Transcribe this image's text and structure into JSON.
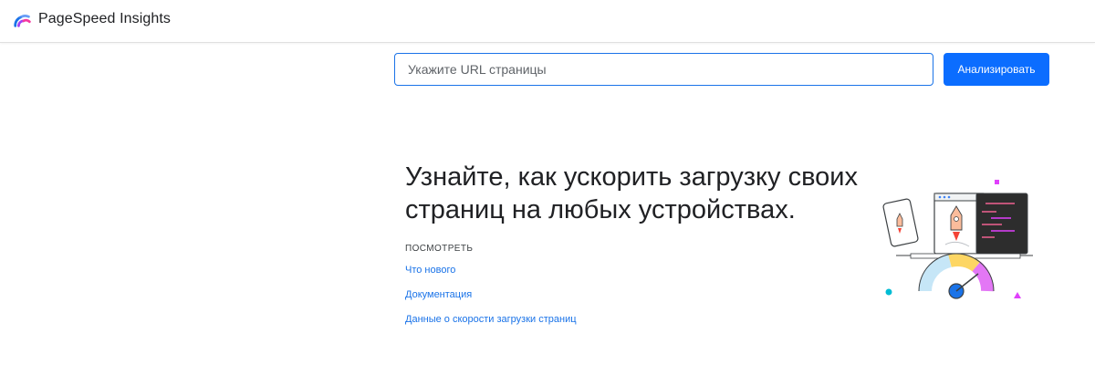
{
  "header": {
    "brand": "PageSpeed Insights",
    "logo_icon": "pagespeed-gauge-icon"
  },
  "search": {
    "placeholder": "Укажите URL страницы",
    "value": "",
    "button_label": "Анализировать"
  },
  "hero": {
    "title_line1": "Узнайте, как ускорить загрузку своих",
    "title_line2": "страниц на любых устройствах.",
    "illustration_icon": "devices-speed-illustration"
  },
  "links": {
    "heading": "ПОСМОТРЕТЬ",
    "items": [
      {
        "label": "Что нового"
      },
      {
        "label": "Документация"
      },
      {
        "label": "Данные о скорости загрузки страниц"
      }
    ]
  },
  "colors": {
    "accent": "#1a73e8",
    "button": "#0b6dff",
    "text": "#202124"
  }
}
